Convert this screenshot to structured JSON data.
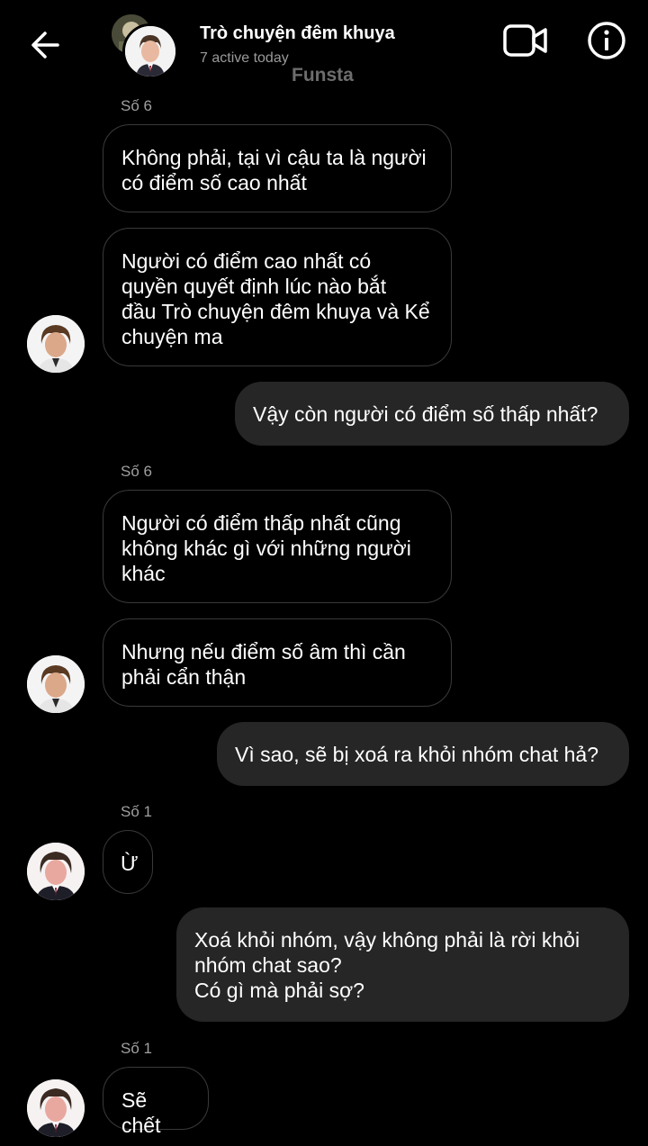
{
  "header": {
    "title": "Trò chuyện đêm khuya",
    "status": "7 active today",
    "watermark": "Funsta"
  },
  "icons": {
    "back": "arrow-left-icon",
    "video": "video-call-icon",
    "info": "info-icon"
  },
  "messages": [
    {
      "type": "sender",
      "text": "Số 6"
    },
    {
      "type": "in",
      "text": "Không phải, tại vì cậu ta là người\ncó điểm số cao nhất"
    },
    {
      "type": "in",
      "text": "Người có điểm cao nhất có\nquyền quyết định lúc nào bắt\nđầu Trò chuyện đêm khuya và Kể\nchuyện ma"
    },
    {
      "type": "out",
      "text": "Vậy còn người có điểm số thấp nhất?"
    },
    {
      "type": "sender",
      "text": "Số 6"
    },
    {
      "type": "in",
      "text": "Người có điểm thấp nhất cũng\nkhông khác gì với những người\nkhác"
    },
    {
      "type": "in",
      "text": "Nhưng nếu điểm số âm thì cần\nphải cẩn thận"
    },
    {
      "type": "out",
      "text": "Vì sao, sẽ bị xoá ra khỏi nhóm chat hả?"
    },
    {
      "type": "sender",
      "text": "Số 1"
    },
    {
      "type": "in",
      "text": "Ừ"
    },
    {
      "type": "out",
      "text": "Xoá khỏi nhóm, vậy không phải là rời khỏi\nnhóm chat sao?\nCó gì mà phải sợ?"
    },
    {
      "type": "sender",
      "text": "Số 1"
    },
    {
      "type": "in",
      "text": "Sẽ chết"
    }
  ]
}
